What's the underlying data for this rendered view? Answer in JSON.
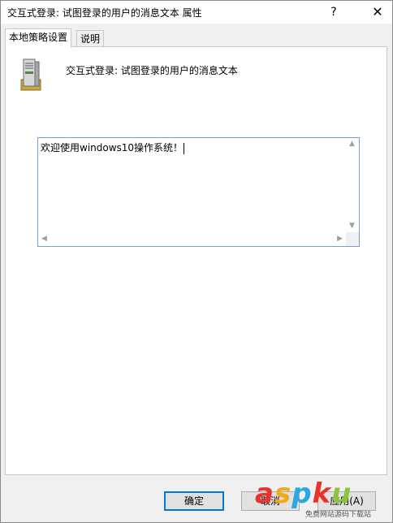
{
  "window": {
    "title": "交互式登录: 试图登录的用户的消息文本 属性",
    "help_label": "?",
    "close_label": "✕"
  },
  "tabs": [
    {
      "label": "本地策略设置",
      "active": true
    },
    {
      "label": "说明",
      "active": false
    }
  ],
  "policy": {
    "icon": "server-icon",
    "name": "交互式登录: 试图登录的用户的消息文本"
  },
  "message_field": {
    "value": "欢迎使用windows10操作系统！"
  },
  "buttons": {
    "ok_label": "确定",
    "cancel_label": "取消",
    "apply_label": "应用(A)"
  },
  "watermark": {
    "text": "aspku",
    "sub": "免费网站源码下载站",
    "colors": {
      "a": "#e8322b",
      "s": "#f2a81d",
      "p": "#2aa8e0",
      "k": "#e8322b",
      "u": "#8bc53f"
    }
  }
}
